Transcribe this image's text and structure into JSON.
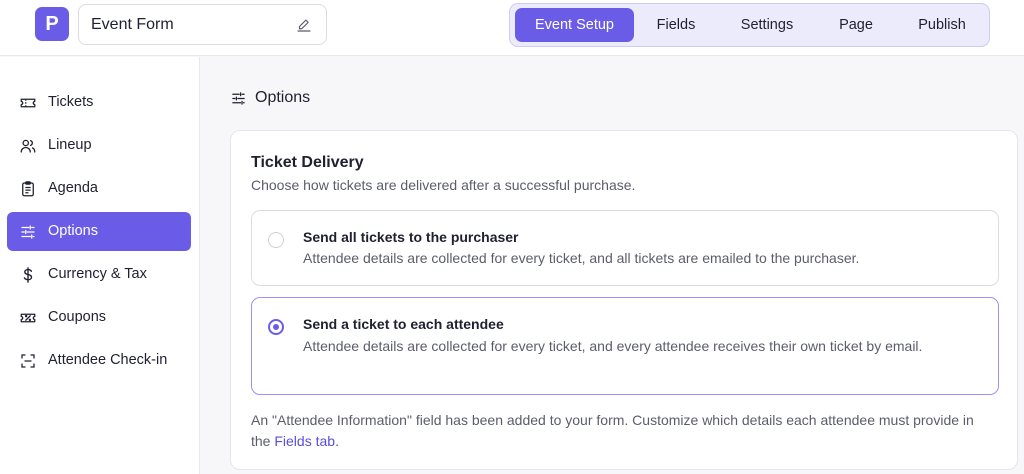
{
  "app": {
    "logo_letter": "P",
    "form_title": "Event Form"
  },
  "tabs": [
    {
      "label": "Event Setup",
      "active": true
    },
    {
      "label": "Fields",
      "active": false
    },
    {
      "label": "Settings",
      "active": false
    },
    {
      "label": "Page",
      "active": false
    },
    {
      "label": "Publish",
      "active": false
    }
  ],
  "sidebar": {
    "items": [
      {
        "label": "Tickets",
        "icon": "ticket-icon"
      },
      {
        "label": "Lineup",
        "icon": "users-icon"
      },
      {
        "label": "Agenda",
        "icon": "clipboard-icon"
      },
      {
        "label": "Options",
        "icon": "sliders-icon",
        "active": true
      },
      {
        "label": "Currency & Tax",
        "icon": "dollar-icon"
      },
      {
        "label": "Coupons",
        "icon": "coupon-icon"
      },
      {
        "label": "Attendee Check-in",
        "icon": "scan-icon"
      }
    ]
  },
  "section": {
    "title": "Options"
  },
  "card": {
    "title": "Ticket Delivery",
    "subtitle": "Choose how tickets are delivered after a successful purchase.",
    "options": [
      {
        "title": "Send all tickets to the purchaser",
        "description": "Attendee details are collected for every ticket, and all tickets are emailed to the purchaser.",
        "selected": false
      },
      {
        "title": "Send a ticket to each attendee",
        "description": "Attendee details are collected for every ticket, and every attendee receives their own ticket by email.",
        "selected": true
      }
    ],
    "note_text": "An \"Attendee Information\" field has been added to your form. Customize which details each attendee must provide in the ",
    "note_link": "Fields tab",
    "note_end": "."
  },
  "colors": {
    "accent": "#6b5ce7",
    "accent_light": "#ecebfb"
  }
}
